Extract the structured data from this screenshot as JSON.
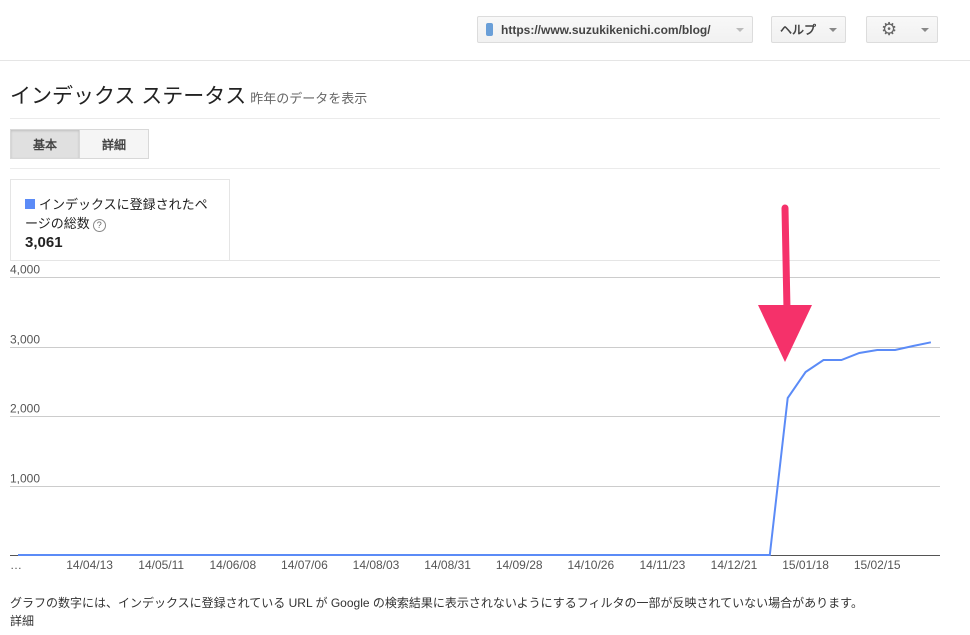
{
  "header": {
    "site_url": "https://www.suzukikenichi.com/blog/",
    "help_label": "ヘルプ",
    "settings_icon": "gear-icon"
  },
  "page": {
    "title": "インデックス ステータス",
    "subtitle": "昨年のデータを表示"
  },
  "tabs": [
    {
      "label": "基本",
      "active": true
    },
    {
      "label": "詳細",
      "active": false
    }
  ],
  "legend": {
    "label": "インデックスに登録されたページの総数",
    "total": "3,061",
    "color": "#5b8bf7"
  },
  "chart_data": {
    "type": "line",
    "title": "インデックスに登録されたページの総数",
    "ylim": [
      0,
      4000
    ],
    "yticks": [
      "4,000",
      "3,000",
      "2,000",
      "1,000"
    ],
    "ytick_values": [
      4000,
      3000,
      2000,
      1000
    ],
    "xtick_first_label": "…",
    "xticks": [
      "14/04/13",
      "14/05/11",
      "14/06/08",
      "14/07/06",
      "14/08/03",
      "14/08/31",
      "14/09/28",
      "14/10/26",
      "14/11/23",
      "14/12/21",
      "15/01/18",
      "15/02/15"
    ],
    "xtick_indices": [
      4,
      8,
      12,
      16,
      20,
      24,
      28,
      32,
      36,
      40,
      44,
      48
    ],
    "series": [
      {
        "name": "インデックスに登録されたページの総数",
        "color": "#5b8bf7",
        "values": [
          0,
          0,
          0,
          0,
          0,
          0,
          0,
          0,
          0,
          0,
          0,
          0,
          0,
          0,
          0,
          0,
          0,
          0,
          0,
          0,
          0,
          0,
          0,
          0,
          0,
          0,
          0,
          0,
          0,
          0,
          0,
          0,
          0,
          0,
          0,
          0,
          0,
          0,
          0,
          0,
          0,
          0,
          0,
          2259,
          2633,
          2806,
          2806,
          2906,
          2950,
          2950,
          3007,
          3061
        ]
      }
    ],
    "annotation_color": "#f5316a"
  },
  "footer": {
    "note": "グラフの数字には、インデックスに登録されている URL が Google の検索結果に表示されないようにするフィルタの一部が反映されていない場合があります。",
    "details_link": "詳細"
  }
}
